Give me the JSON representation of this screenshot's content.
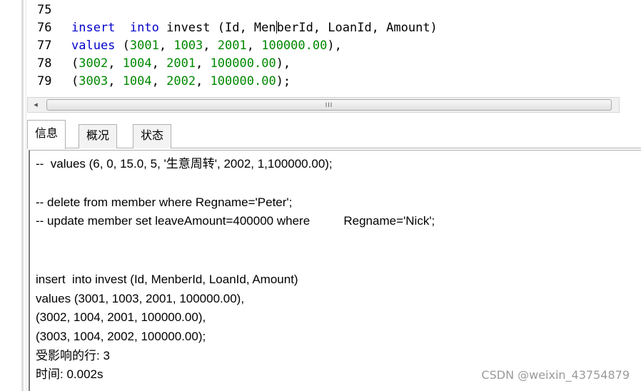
{
  "editor": {
    "lines": [
      {
        "num": "75",
        "parts": []
      },
      {
        "num": "76",
        "parts": [
          {
            "t": "kw",
            "v": "insert"
          },
          {
            "t": "txt",
            "v": "  "
          },
          {
            "t": "kw",
            "v": "into"
          },
          {
            "t": "txt",
            "v": " invest (Id, Men"
          },
          {
            "t": "caret",
            "v": ""
          },
          {
            "t": "txt",
            "v": "berId, LoanId, Amount)"
          }
        ]
      },
      {
        "num": "77",
        "parts": [
          {
            "t": "kw",
            "v": "values"
          },
          {
            "t": "txt",
            "v": " ("
          },
          {
            "t": "num",
            "v": "3001"
          },
          {
            "t": "txt",
            "v": ", "
          },
          {
            "t": "num",
            "v": "1003"
          },
          {
            "t": "txt",
            "v": ", "
          },
          {
            "t": "num",
            "v": "2001"
          },
          {
            "t": "txt",
            "v": ", "
          },
          {
            "t": "num",
            "v": "100000.00"
          },
          {
            "t": "txt",
            "v": "),"
          }
        ]
      },
      {
        "num": "78",
        "parts": [
          {
            "t": "txt",
            "v": "("
          },
          {
            "t": "num",
            "v": "3002"
          },
          {
            "t": "txt",
            "v": ", "
          },
          {
            "t": "num",
            "v": "1004"
          },
          {
            "t": "txt",
            "v": ", "
          },
          {
            "t": "num",
            "v": "2001"
          },
          {
            "t": "txt",
            "v": ", "
          },
          {
            "t": "num",
            "v": "100000.00"
          },
          {
            "t": "txt",
            "v": "),"
          }
        ]
      },
      {
        "num": "79",
        "parts": [
          {
            "t": "txt",
            "v": "("
          },
          {
            "t": "num",
            "v": "3003"
          },
          {
            "t": "txt",
            "v": ", "
          },
          {
            "t": "num",
            "v": "1004"
          },
          {
            "t": "txt",
            "v": ", "
          },
          {
            "t": "num",
            "v": "2002"
          },
          {
            "t": "txt",
            "v": ", "
          },
          {
            "t": "num",
            "v": "100000.00"
          },
          {
            "t": "txt",
            "v": ");"
          }
        ]
      }
    ]
  },
  "scrollbar": {
    "left_arrow": "◂",
    "grip": "III"
  },
  "tabs": [
    {
      "label": "信息",
      "active": true
    },
    {
      "label": "概况",
      "active": false
    },
    {
      "label": "状态",
      "active": false
    }
  ],
  "output": {
    "lines": [
      "--  values (6, 0, 15.0, 5, '生意周转', 2002, 1,100000.00);",
      "",
      "-- delete from member where Regname='Peter';",
      "-- update member set leaveAmount=400000 where          Regname='Nick';",
      "",
      "",
      "insert  into invest (Id, MenberId, LoanId, Amount)",
      "values (3001, 1003, 2001, 100000.00),",
      "(3002, 1004, 2001, 100000.00),",
      "(3003, 1004, 2002, 100000.00);",
      "受影响的行: 3",
      "时间: 0.002s"
    ]
  },
  "watermark": "CSDN @weixin_43754879"
}
